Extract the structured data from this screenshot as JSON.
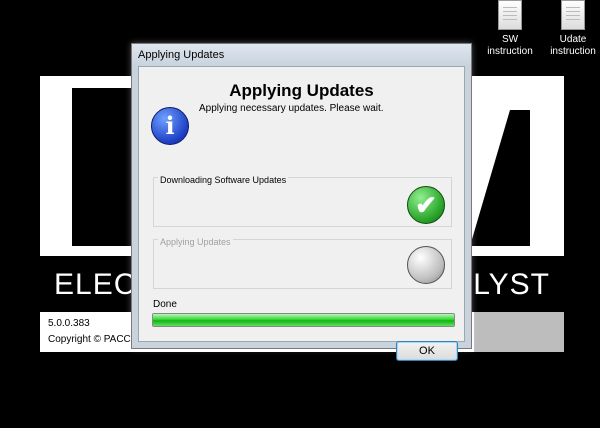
{
  "desktop": {
    "icons": [
      {
        "label_line1": "SW",
        "label_line2": "instruction"
      },
      {
        "label_line1": "Udate",
        "label_line2": "instruction"
      }
    ]
  },
  "splash": {
    "tagline_left": "ELEC",
    "tagline_right": "LYST",
    "version": "5.0.0.383",
    "copyright": "Copyright © PACC"
  },
  "dialog": {
    "window_title": "Applying Updates",
    "header_title": "Applying Updates",
    "header_subtitle": "Applying necessary updates.  Please wait.",
    "info_icon_glyph": "i",
    "groups": [
      {
        "label": "Downloading Software Updates",
        "status": "complete"
      },
      {
        "label": "Applying Updates",
        "status": "pending"
      }
    ],
    "progress_label": "Done",
    "progress": 1.0,
    "ok_label": "OK"
  }
}
